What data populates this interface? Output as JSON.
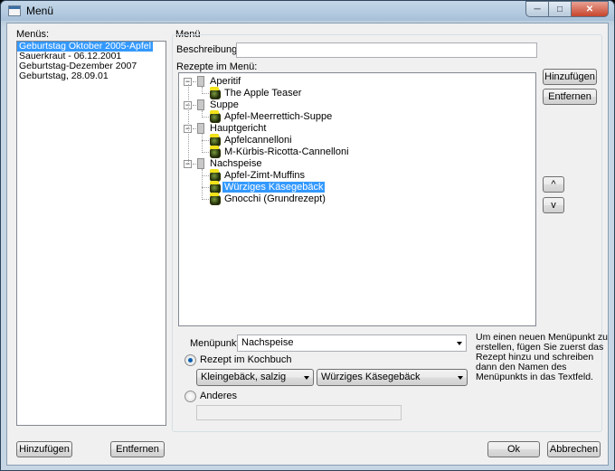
{
  "window": {
    "title": "Menü"
  },
  "left": {
    "label": "Menüs:",
    "items": [
      {
        "text": "Geburtstag Oktober 2005-Apfel",
        "selected": true
      },
      {
        "text": "Sauerkraut - 06.12.2001",
        "selected": false
      },
      {
        "text": "Geburtstag-Dezember 2007",
        "selected": false
      },
      {
        "text": "Geburtstag, 28.09.01",
        "selected": false
      }
    ],
    "add_button": "Hinzufügen",
    "remove_button": "Entfernen"
  },
  "menu": {
    "group_label": "Menü",
    "description_label": "Beschreibung:",
    "description_value": "",
    "recipes_label": "Rezepte im Menü:",
    "tree": [
      {
        "label": "Aperitif",
        "children": [
          "The Apple Teaser"
        ]
      },
      {
        "label": "Suppe",
        "children": [
          "Apfel-Meerrettich-Suppe"
        ]
      },
      {
        "label": "Hauptgericht",
        "children": [
          "Apfelcannelloni",
          "M-Kürbis-Ricotta-Cannelloni"
        ]
      },
      {
        "label": "Nachspeise",
        "children": [
          "Apfel-Zimt-Muffins",
          "Würziges Käsegebäck",
          "Gnocchi (Grundrezept)"
        ]
      }
    ],
    "selected_item": "Würziges Käsegebäck",
    "add_button": "Hinzufügen",
    "remove_button": "Entfernen",
    "up_button": "^",
    "down_button": "v",
    "menupunkt_label": "Menüpunkt:",
    "menupunkt_value": "Nachspeise",
    "radio_cookbook_label": "Rezept im Kochbuch",
    "category_value": "Kleingebäck, salzig",
    "recipe_value": "Würziges Käsegebäck",
    "radio_other_label": "Anderes",
    "other_value": "",
    "info_lines": [
      "Um einen neuen Menüpunkt zu",
      "erstellen, fügen Sie zuerst das",
      "Rezept hinzu und schreiben",
      "dann den Namen des",
      "Menüpunkts in das Textfeld."
    ]
  },
  "footer": {
    "ok_button": "Ok",
    "cancel_button": "Abbrechen"
  }
}
